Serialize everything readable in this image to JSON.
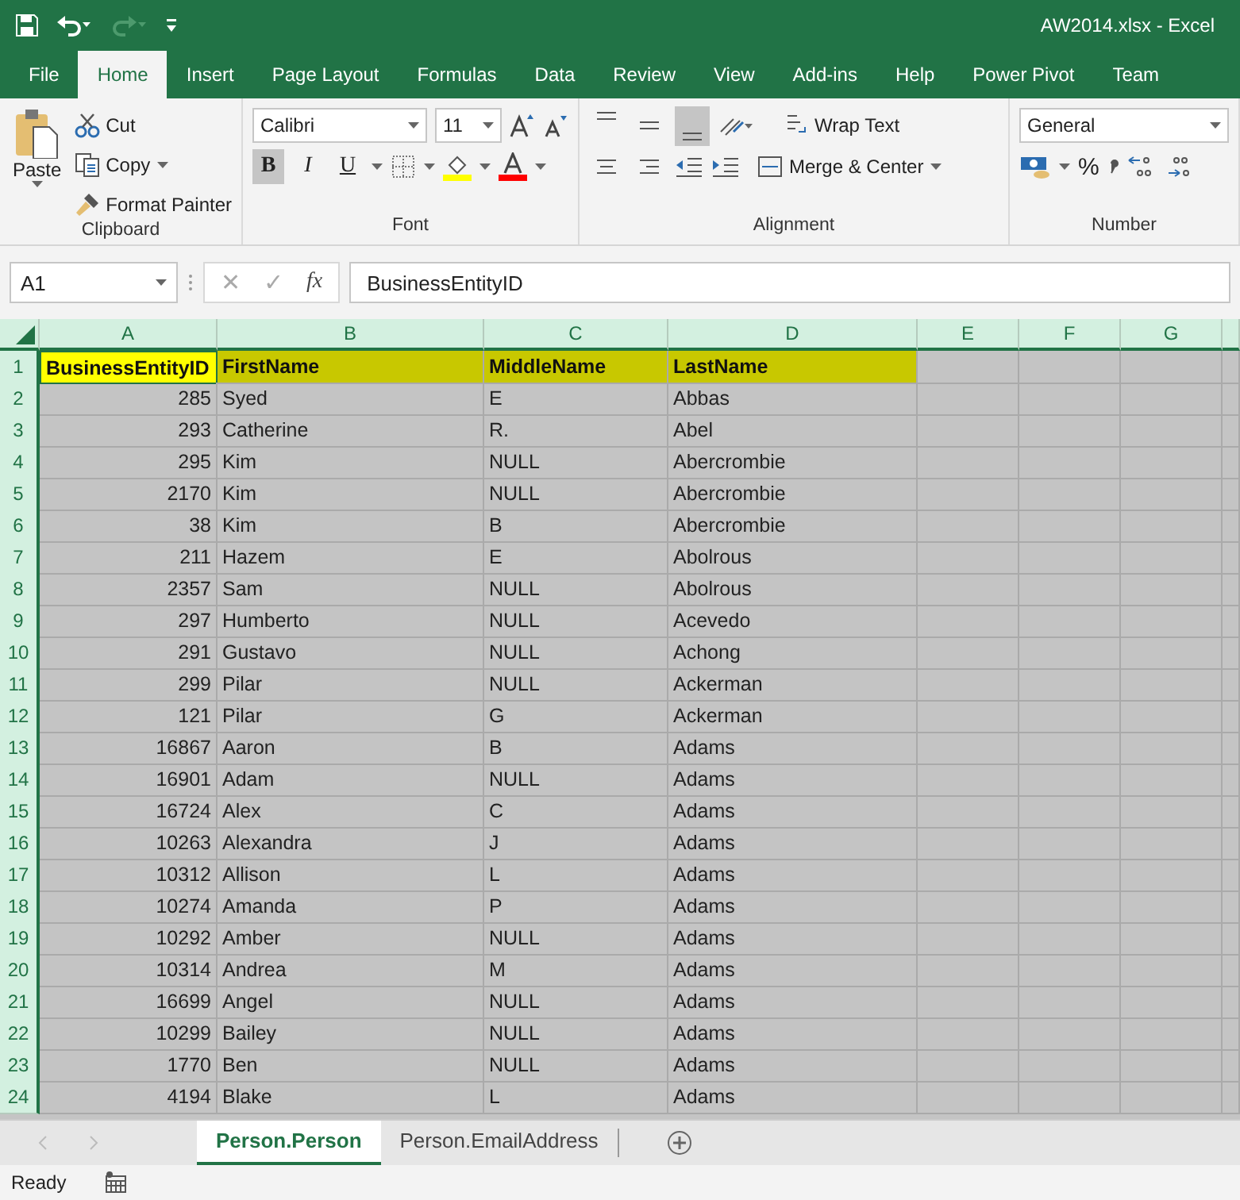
{
  "window": {
    "title": "AW2014.xlsx  -  Excel"
  },
  "ribbon_tabs": [
    {
      "label": "File",
      "selected": false
    },
    {
      "label": "Home",
      "selected": true
    },
    {
      "label": "Insert",
      "selected": false
    },
    {
      "label": "Page Layout",
      "selected": false
    },
    {
      "label": "Formulas",
      "selected": false
    },
    {
      "label": "Data",
      "selected": false
    },
    {
      "label": "Review",
      "selected": false
    },
    {
      "label": "View",
      "selected": false
    },
    {
      "label": "Add-ins",
      "selected": false
    },
    {
      "label": "Help",
      "selected": false
    },
    {
      "label": "Power Pivot",
      "selected": false
    },
    {
      "label": "Team",
      "selected": false
    }
  ],
  "clipboard": {
    "paste": "Paste",
    "cut": "Cut",
    "copy": "Copy",
    "format_painter": "Format Painter",
    "group": "Clipboard"
  },
  "font": {
    "name": "Calibri",
    "size": "11",
    "group": "Font",
    "styles": [
      {
        "label": "B",
        "selected": true
      },
      {
        "label": "I",
        "selected": false
      },
      {
        "label": "U",
        "selected": false
      }
    ]
  },
  "alignment": {
    "group": "Alignment",
    "vertical_align": [
      {
        "selected": false
      },
      {
        "selected": false
      },
      {
        "selected": true
      }
    ],
    "wrap_text": "Wrap Text",
    "merge_center": "Merge & Center"
  },
  "number": {
    "group": "Number",
    "format": "General",
    "percent": "%"
  },
  "formula_bar": {
    "name_box": "A1",
    "cancel": "✕",
    "enter": "✓",
    "function": "fx",
    "formula": "BusinessEntityID"
  },
  "columns": [
    "A",
    "B",
    "C",
    "D",
    "E",
    "F",
    "G"
  ],
  "header_row": {
    "number": "1",
    "cells": [
      {
        "text": "BusinessEntityID",
        "active": true
      },
      {
        "text": "FirstName",
        "active": false
      },
      {
        "text": "MiddleName",
        "active": false
      },
      {
        "text": "LastName",
        "active": false
      }
    ]
  },
  "rows": [
    {
      "number": "2",
      "cells": [
        "285",
        "Syed",
        "E",
        "Abbas"
      ]
    },
    {
      "number": "3",
      "cells": [
        "293",
        "Catherine",
        "R.",
        "Abel"
      ]
    },
    {
      "number": "4",
      "cells": [
        "295",
        "Kim",
        "NULL",
        "Abercrombie"
      ]
    },
    {
      "number": "5",
      "cells": [
        "2170",
        "Kim",
        "NULL",
        "Abercrombie"
      ]
    },
    {
      "number": "6",
      "cells": [
        "38",
        "Kim",
        "B",
        "Abercrombie"
      ]
    },
    {
      "number": "7",
      "cells": [
        "211",
        "Hazem",
        "E",
        "Abolrous"
      ]
    },
    {
      "number": "8",
      "cells": [
        "2357",
        "Sam",
        "NULL",
        "Abolrous"
      ]
    },
    {
      "number": "9",
      "cells": [
        "297",
        "Humberto",
        "NULL",
        "Acevedo"
      ]
    },
    {
      "number": "10",
      "cells": [
        "291",
        "Gustavo",
        "NULL",
        "Achong"
      ]
    },
    {
      "number": "11",
      "cells": [
        "299",
        "Pilar",
        "NULL",
        "Ackerman"
      ]
    },
    {
      "number": "12",
      "cells": [
        "121",
        "Pilar",
        "G",
        "Ackerman"
      ]
    },
    {
      "number": "13",
      "cells": [
        "16867",
        "Aaron",
        "B",
        "Adams"
      ]
    },
    {
      "number": "14",
      "cells": [
        "16901",
        "Adam",
        "NULL",
        "Adams"
      ]
    },
    {
      "number": "15",
      "cells": [
        "16724",
        "Alex",
        "C",
        "Adams"
      ]
    },
    {
      "number": "16",
      "cells": [
        "10263",
        "Alexandra",
        "J",
        "Adams"
      ]
    },
    {
      "number": "17",
      "cells": [
        "10312",
        "Allison",
        "L",
        "Adams"
      ]
    },
    {
      "number": "18",
      "cells": [
        "10274",
        "Amanda",
        "P",
        "Adams"
      ]
    },
    {
      "number": "19",
      "cells": [
        "10292",
        "Amber",
        "NULL",
        "Adams"
      ]
    },
    {
      "number": "20",
      "cells": [
        "10314",
        "Andrea",
        "M",
        "Adams"
      ]
    },
    {
      "number": "21",
      "cells": [
        "16699",
        "Angel",
        "NULL",
        "Adams"
      ]
    },
    {
      "number": "22",
      "cells": [
        "10299",
        "Bailey",
        "NULL",
        "Adams"
      ]
    },
    {
      "number": "23",
      "cells": [
        "1770",
        "Ben",
        "NULL",
        "Adams"
      ]
    },
    {
      "number": "24",
      "cells": [
        "4194",
        "Blake",
        "L",
        "Adams"
      ]
    }
  ],
  "sheet_tabs": [
    {
      "label": "Person.Person",
      "selected": true
    },
    {
      "label": "Person.EmailAddress",
      "selected": false
    }
  ],
  "status_bar": {
    "text": "Ready"
  }
}
